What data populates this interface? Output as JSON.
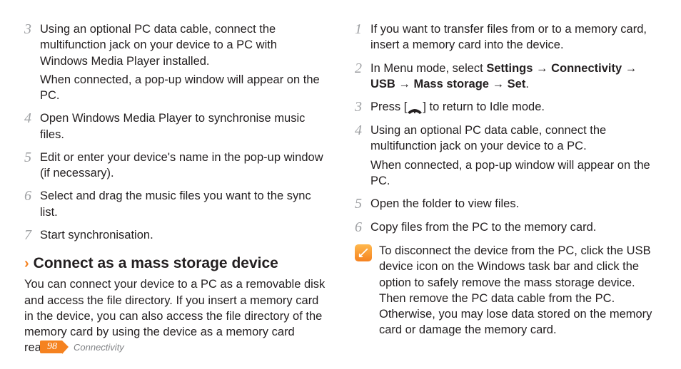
{
  "left": {
    "steps": [
      {
        "num": "3",
        "paras": [
          "Using an optional PC data cable, connect the multifunction jack on your device to a PC with Windows Media Player installed.",
          "When connected, a pop-up window will appear on the PC."
        ]
      },
      {
        "num": "4",
        "paras": [
          "Open Windows Media Player to synchronise music files."
        ]
      },
      {
        "num": "5",
        "paras": [
          "Edit or enter your device's name in the pop-up window (if necessary)."
        ]
      },
      {
        "num": "6",
        "paras": [
          "Select and drag the music files you want to the sync list."
        ]
      },
      {
        "num": "7",
        "paras": [
          "Start synchronisation."
        ]
      }
    ],
    "section_title": "Connect as a mass storage device",
    "intro": "You can connect your device to a PC as a removable disk and access the file directory. If you insert a memory card in the device, you can also access the file directory of the memory card by using the device as a memory card reader."
  },
  "right": {
    "steps": [
      {
        "num": "1",
        "paras": [
          "If you want to transfer files from or to a memory card, insert a memory card into the device."
        ]
      },
      {
        "num": "2",
        "rich": {
          "pre": "In Menu mode, select ",
          "bold_parts": [
            "Settings",
            " → ",
            "Connectivity",
            " → ",
            "USB",
            " → ",
            "Mass storage",
            " → ",
            "Set"
          ],
          "post": "."
        }
      },
      {
        "num": "3",
        "key_line": {
          "pre": "Press [",
          "post": "] to return to Idle mode."
        }
      },
      {
        "num": "4",
        "paras": [
          "Using an optional PC data cable, connect the multifunction jack on your device to a PC.",
          "When connected, a pop-up window will appear on the PC."
        ]
      },
      {
        "num": "5",
        "paras": [
          "Open the folder to view files."
        ]
      },
      {
        "num": "6",
        "paras": [
          "Copy files from the PC to the memory card."
        ]
      }
    ],
    "note": "To disconnect the device from the PC, click the USB device icon on the Windows task bar and click the option to safely remove the mass storage device. Then remove the PC data cable from the PC. Otherwise, you may lose data stored on the memory card or damage the memory card."
  },
  "footer": {
    "page": "98",
    "section": "Connectivity"
  }
}
